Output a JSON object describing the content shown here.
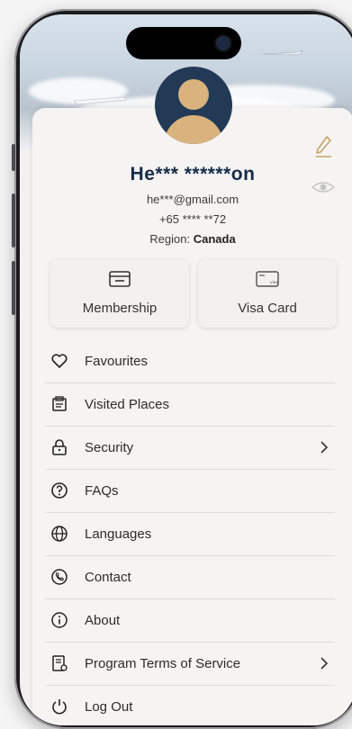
{
  "profile": {
    "name": "He*** ******on",
    "email": "he***@gmail.com",
    "phone": "+65 **** **72",
    "region_label": "Region:",
    "region_value": "Canada"
  },
  "tiles": [
    {
      "label": "Membership",
      "icon": "membership-card-icon"
    },
    {
      "label": "Visa Card",
      "icon": "visa-card-icon"
    }
  ],
  "menu": [
    {
      "label": "Favourites",
      "icon": "heart-icon",
      "chevron": false
    },
    {
      "label": "Visited Places",
      "icon": "visited-places-icon",
      "chevron": false
    },
    {
      "label": "Security",
      "icon": "lock-icon",
      "chevron": true
    },
    {
      "label": "FAQs",
      "icon": "question-icon",
      "chevron": false
    },
    {
      "label": "Languages",
      "icon": "globe-icon",
      "chevron": false
    },
    {
      "label": "Contact",
      "icon": "phone-icon",
      "chevron": false
    },
    {
      "label": "About",
      "icon": "info-icon",
      "chevron": false
    },
    {
      "label": "Program Terms of Service",
      "icon": "document-icon",
      "chevron": true
    },
    {
      "label": "Log Out",
      "icon": "power-icon",
      "chevron": false
    }
  ],
  "colors": {
    "accent_gold": "#c9a46a",
    "name_navy": "#162c4a",
    "avatar_bg": "#223a56"
  }
}
